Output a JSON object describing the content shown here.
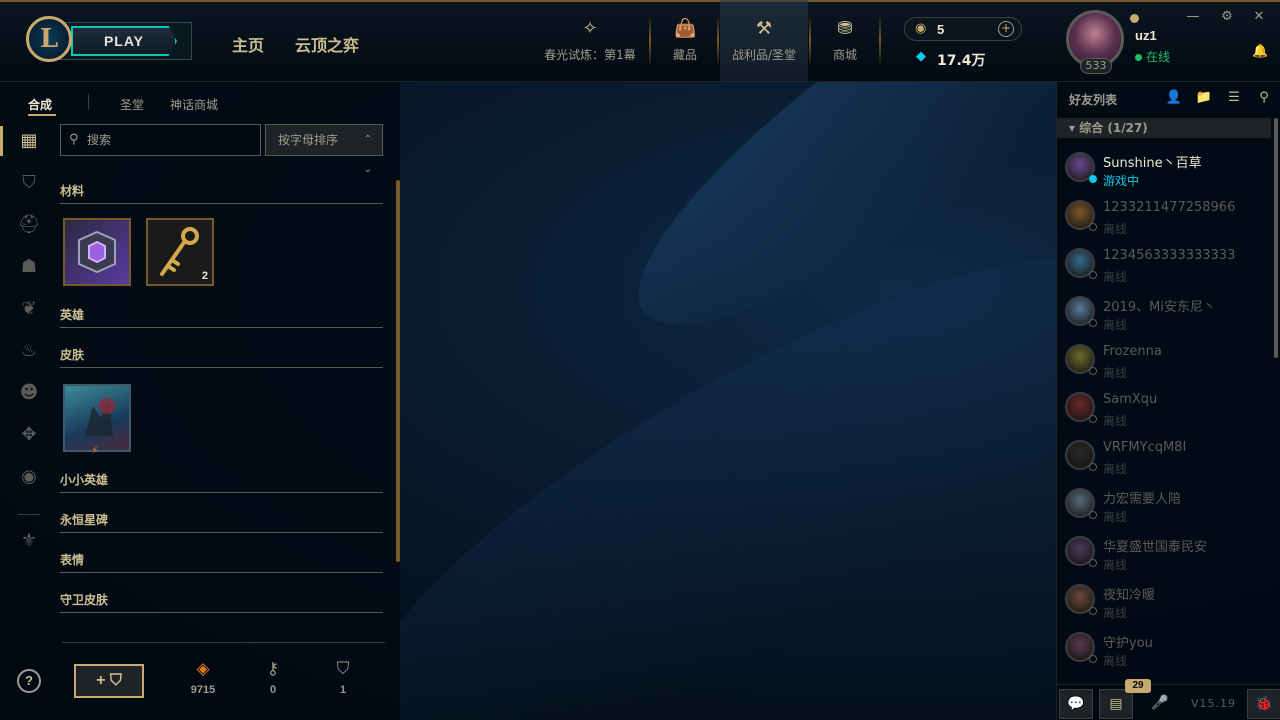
{
  "header": {
    "play_label": "PLAY",
    "nav_home": "主页",
    "nav_tft": "云顶之弈",
    "nav_items": [
      {
        "label": "春光试炼：第1幕",
        "icon": "pass-icon"
      },
      {
        "label": "藏品",
        "icon": "collection-icon"
      },
      {
        "label": "战利品/圣堂",
        "icon": "loot-icon"
      },
      {
        "label": "商城",
        "icon": "store-icon"
      }
    ],
    "rp": "5",
    "blue_essence": "17.4万",
    "username": "uz1",
    "status": "在线",
    "level": "533"
  },
  "left": {
    "tabs": [
      "合成",
      "圣堂",
      "神话商城"
    ],
    "search_placeholder": "搜索",
    "sort_label": "按字母排序",
    "sections": {
      "materials": "材料",
      "champions": "英雄",
      "skins": "皮肤",
      "little_legends": "小小英雄",
      "eternals": "永恒星碑",
      "emotes": "表情",
      "ward_skins": "守卫皮肤"
    },
    "key_count": "2",
    "resources": [
      {
        "name": "orange-essence",
        "value": "9715"
      },
      {
        "name": "key",
        "value": "0"
      },
      {
        "name": "chest",
        "value": "1"
      }
    ],
    "help": "?",
    "craft_label": "+"
  },
  "friends": {
    "title": "好友列表",
    "group": "综合 (1/27)",
    "list": [
      {
        "name": "Sunshine丶百草",
        "status": "游戏中",
        "online": true,
        "color": "#6a4a8a"
      },
      {
        "name": "1233211477258966",
        "status": "离线",
        "online": false,
        "color": "#7a5a2a"
      },
      {
        "name": "1234563333333333",
        "status": "离线",
        "online": false,
        "color": "#3a6a8a"
      },
      {
        "name": "2019、Mi安东尼丶",
        "status": "离线",
        "online": false,
        "color": "#5a7a9a"
      },
      {
        "name": "Frozenna",
        "status": "离线",
        "online": false,
        "color": "#6a6a2a"
      },
      {
        "name": "SamXqu",
        "status": "离线",
        "online": false,
        "color": "#6a2a2a"
      },
      {
        "name": "VRFMYcqM8I",
        "status": "离线",
        "online": false,
        "color": "#2a2a2a"
      },
      {
        "name": "力宏需要人陪",
        "status": "离线",
        "online": false,
        "color": "#5a6a7a"
      },
      {
        "name": "华夏盛世国泰民安",
        "status": "离线",
        "online": false,
        "color": "#4a3a5a"
      },
      {
        "name": "夜知冷暖",
        "status": "离线",
        "online": false,
        "color": "#6a4a3a"
      },
      {
        "name": "守护you",
        "status": "离线",
        "online": false,
        "color": "#5a3a4a"
      }
    ],
    "chat_badge": "29",
    "version": "V15.19"
  }
}
